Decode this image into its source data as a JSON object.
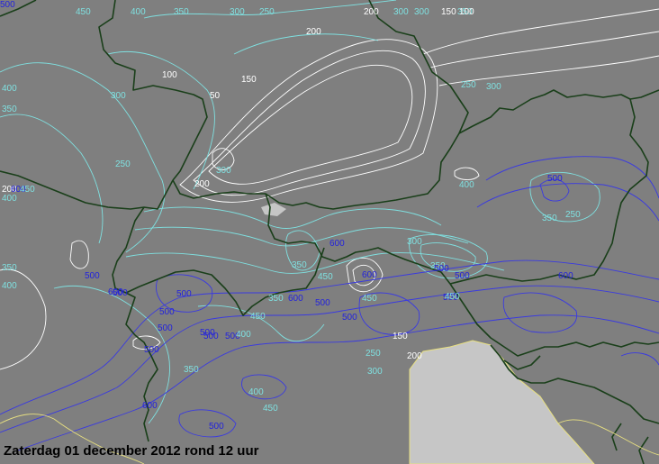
{
  "caption": "Zaterdag 01 december 2012 rond 12 uur",
  "colors": {
    "land": "#7f7f7f",
    "sea": "#c6c6c6",
    "border": "#1a3f1a",
    "coast": "#e8e080",
    "contour_white": "#ffffff",
    "contour_cyan": "#7fe0e0",
    "contour_blue": "#3a3ae0"
  },
  "contour_labels": [
    {
      "text": "450",
      "c": "cyan"
    },
    {
      "text": "400",
      "c": "cyan"
    },
    {
      "text": "350",
      "c": "cyan"
    },
    {
      "text": "300",
      "c": "cyan"
    },
    {
      "text": "250",
      "c": "cyan"
    },
    {
      "text": "200",
      "c": "white"
    },
    {
      "text": "150",
      "c": "white"
    },
    {
      "text": "100",
      "c": "white"
    },
    {
      "text": "50",
      "c": "white"
    },
    {
      "text": "300",
      "c": "cyan"
    },
    {
      "text": "400",
      "c": "cyan"
    },
    {
      "text": "350",
      "c": "cyan"
    },
    {
      "text": "250",
      "c": "cyan"
    },
    {
      "text": "200",
      "c": "white"
    },
    {
      "text": "300",
      "c": "cyan"
    },
    {
      "text": "300",
      "c": "cyan"
    },
    {
      "text": "150",
      "c": "white"
    },
    {
      "text": "350",
      "c": "cyan"
    },
    {
      "text": "100",
      "c": "white"
    },
    {
      "text": "300",
      "c": "cyan"
    },
    {
      "text": "250",
      "c": "cyan"
    },
    {
      "text": "300",
      "c": "cyan"
    },
    {
      "text": "200",
      "c": "white"
    },
    {
      "text": "200",
      "c": "white"
    },
    {
      "text": "600",
      "c": "blue"
    },
    {
      "text": "450",
      "c": "cyan"
    },
    {
      "text": "400",
      "c": "cyan"
    },
    {
      "text": "400",
      "c": "cyan"
    },
    {
      "text": "500",
      "c": "blue"
    },
    {
      "text": "350",
      "c": "cyan"
    },
    {
      "text": "250",
      "c": "cyan"
    },
    {
      "text": "600",
      "c": "blue"
    },
    {
      "text": "300",
      "c": "cyan"
    },
    {
      "text": "350",
      "c": "cyan"
    },
    {
      "text": "500",
      "c": "blue"
    },
    {
      "text": "600",
      "c": "blue"
    },
    {
      "text": "500",
      "c": "blue"
    },
    {
      "text": "450",
      "c": "cyan"
    },
    {
      "text": "500",
      "c": "blue"
    },
    {
      "text": "350",
      "c": "cyan"
    },
    {
      "text": "400",
      "c": "cyan"
    },
    {
      "text": "500",
      "c": "blue"
    },
    {
      "text": "600",
      "c": "blue"
    },
    {
      "text": "500",
      "c": "blue"
    },
    {
      "text": "500",
      "c": "blue"
    },
    {
      "text": "350",
      "c": "cyan"
    },
    {
      "text": "450",
      "c": "cyan"
    },
    {
      "text": "500",
      "c": "blue"
    },
    {
      "text": "600",
      "c": "blue"
    },
    {
      "text": "450",
      "c": "cyan"
    },
    {
      "text": "350",
      "c": "cyan"
    },
    {
      "text": "600",
      "c": "blue"
    },
    {
      "text": "500",
      "c": "blue"
    },
    {
      "text": "500",
      "c": "blue"
    },
    {
      "text": "500",
      "c": "blue"
    },
    {
      "text": "500",
      "c": "blue"
    },
    {
      "text": "500",
      "c": "blue"
    },
    {
      "text": "400",
      "c": "cyan"
    },
    {
      "text": "450",
      "c": "cyan"
    },
    {
      "text": "500",
      "c": "blue"
    },
    {
      "text": "150",
      "c": "white"
    },
    {
      "text": "200",
      "c": "white"
    },
    {
      "text": "250",
      "c": "cyan"
    },
    {
      "text": "300",
      "c": "cyan"
    },
    {
      "text": "350",
      "c": "cyan"
    },
    {
      "text": "400",
      "c": "cyan"
    },
    {
      "text": "450",
      "c": "cyan"
    },
    {
      "text": "500",
      "c": "blue"
    },
    {
      "text": "600",
      "c": "blue"
    },
    {
      "text": "500",
      "c": "blue"
    },
    {
      "text": "500",
      "c": "blue"
    }
  ]
}
